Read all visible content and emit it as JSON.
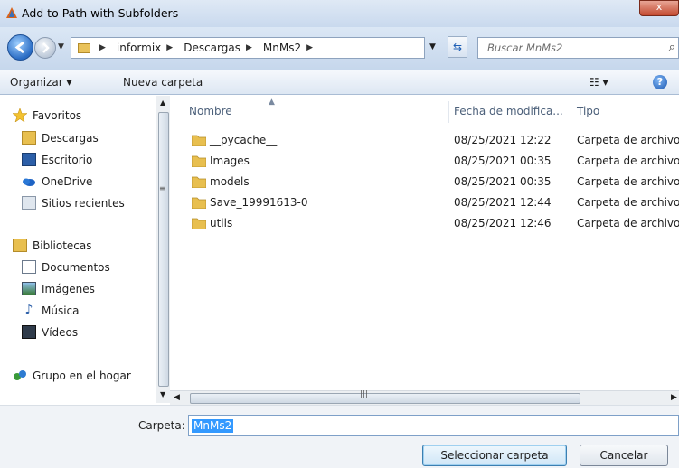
{
  "window": {
    "title": "Add to Path with Subfolders",
    "close_glyph": "x"
  },
  "address_bar": {
    "crumbs": [
      "informix",
      "Descargas",
      "MnMs2"
    ],
    "search_placeholder": "Buscar MnMs2"
  },
  "toolbar": {
    "organize_label": "Organizar ▾",
    "new_folder_label": "Nueva carpeta",
    "views_glyph": "☷ ▾",
    "help_glyph": "?"
  },
  "nav_pane": {
    "favorites_label": "Favoritos",
    "favorites": [
      "Descargas",
      "Escritorio",
      "OneDrive",
      "Sitios recientes"
    ],
    "libraries_label": "Bibliotecas",
    "libraries": [
      "Documentos",
      "Imágenes",
      "Música",
      "Vídeos"
    ],
    "homegroup_label": "Grupo en el hogar"
  },
  "file_list": {
    "columns": {
      "name": "Nombre",
      "date": "Fecha de modifica...",
      "type": "Tipo"
    },
    "rows": [
      {
        "name": "__pycache__",
        "date": "08/25/2021 12:22",
        "type": "Carpeta de archivos"
      },
      {
        "name": "Images",
        "date": "08/25/2021 00:35",
        "type": "Carpeta de archivos"
      },
      {
        "name": "models",
        "date": "08/25/2021 00:35",
        "type": "Carpeta de archivos"
      },
      {
        "name": "Save_19991613-0",
        "date": "08/25/2021 12:44",
        "type": "Carpeta de archivos"
      },
      {
        "name": "utils",
        "date": "08/25/2021 12:46",
        "type": "Carpeta de archivos"
      }
    ]
  },
  "footer": {
    "folder_label": "Carpeta:",
    "folder_value": "MnMs2",
    "select_button": "Seleccionar carpeta",
    "cancel_button": "Cancelar"
  },
  "colors": {
    "folder_yellow": "#e8bf4f",
    "selection_blue": "#3399ff",
    "accent": "#2a6cc4"
  },
  "icons": [
    "app-icon",
    "back-arrow-icon",
    "forward-arrow-icon",
    "folder-icon",
    "refresh-icon",
    "search-icon",
    "help-icon",
    "star-icon",
    "library-icon",
    "onedrive-icon",
    "homegroup-icon"
  ]
}
